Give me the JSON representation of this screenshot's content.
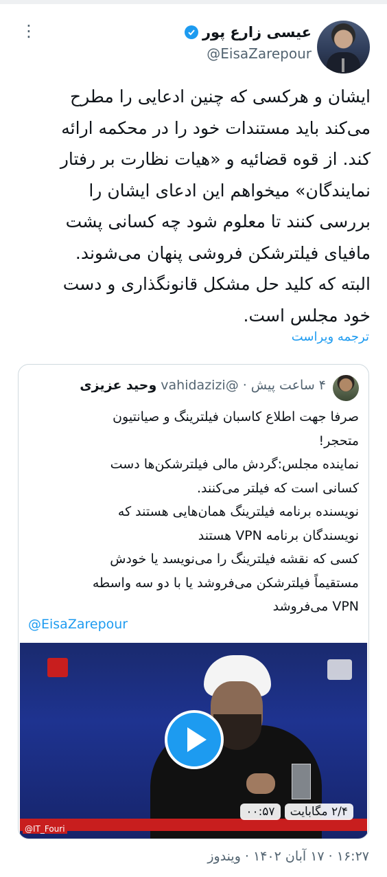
{
  "author": {
    "name": "عیسی زارع پور",
    "handle": "@EisaZarepour"
  },
  "tweet": {
    "lines": [
      "ایشان و هرکسی که چنین ادعایی را مطرح",
      "می‌کند باید مستندات خود را در محکمه ارائه",
      "کند. از قوه قضائیه و «هیات نظارت بر رفتار",
      "نمایندگان» میخواهم این ادعای ایشان را",
      "بررسی کنند تا معلوم شود چه کسانی پشت",
      "مافیای فیلترشکن فروشی پنهان می‌شوند.",
      "البته که کلید حل مشکل قانونگذاری و دست",
      "خود مجلس است."
    ],
    "translate_label": "ترجمه ویراست",
    "footer": "۱۶:۲۷ · ۱۷ آبان ۱۴۰۲ · ویندوز"
  },
  "quoted": {
    "name": "وحید عزیزی",
    "handle": "@vahidazizi",
    "dot": "·",
    "time": "۴ ساعت پیش",
    "lines": [
      "صرفا جهت اطلاع کاسبان فیلترینگ و صیانتیون",
      "متحجر!",
      " نماینده مجلس:گردش مالی فیلترشکن‌ها دست",
      "کسانی است که فیلتر می‌کنند.",
      "نویسنده برنامه فیلترینگ همان‌هایی هستند که",
      "نویسندگان برنامه VPN هستند",
      "کسی که نقشه فیلترینگ را می‌نویسد یا خودش",
      "مستقیماً فیلترشکن می‌فروشد یا با دو سه واسطه",
      "VPN می‌فروشد"
    ],
    "mention": "@EisaZarepour",
    "video": {
      "size": "۲/۴ مگابایت",
      "duration": "۰۰:۵۷",
      "watermark": "@IT_Fouri"
    }
  },
  "icons": {
    "more": "more-vertical-icon",
    "verified": "verified-badge-icon",
    "play": "play-icon"
  },
  "colors": {
    "accent": "#1d9bf0",
    "secondary_text": "#536471",
    "border": "#cfd9de"
  }
}
